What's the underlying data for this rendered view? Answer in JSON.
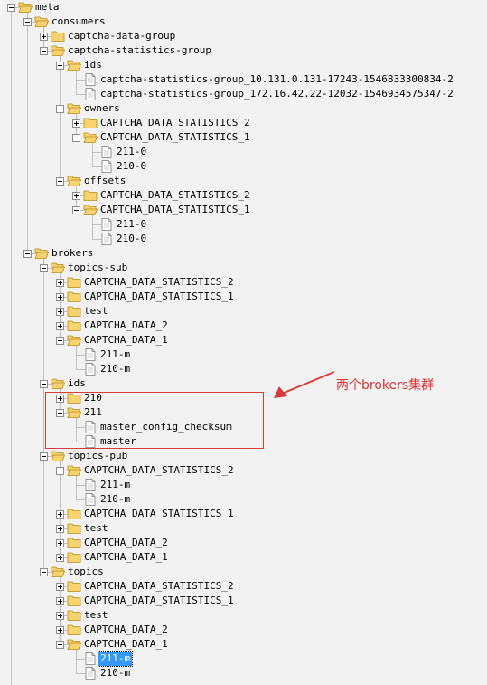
{
  "tree": [
    {
      "label": "meta",
      "type": "folder",
      "depth": 0,
      "expanded": true
    },
    {
      "label": "consumers",
      "type": "folder",
      "depth": 1,
      "expanded": true
    },
    {
      "label": "captcha-data-group",
      "type": "folder",
      "depth": 2,
      "expanded": false
    },
    {
      "label": "captcha-statistics-group",
      "type": "folder",
      "depth": 2,
      "expanded": true
    },
    {
      "label": "ids",
      "type": "folder",
      "depth": 3,
      "expanded": true
    },
    {
      "label": "captcha-statistics-group_10.131.0.131-17243-1546833300834-2",
      "type": "file",
      "depth": 4
    },
    {
      "label": "captcha-statistics-group_172.16.42.22-12032-1546934575347-2",
      "type": "file",
      "depth": 4
    },
    {
      "label": "owners",
      "type": "folder",
      "depth": 3,
      "expanded": true
    },
    {
      "label": "CAPTCHA_DATA_STATISTICS_2",
      "type": "folder",
      "depth": 4,
      "expanded": false
    },
    {
      "label": "CAPTCHA_DATA_STATISTICS_1",
      "type": "folder",
      "depth": 4,
      "expanded": true
    },
    {
      "label": "211-0",
      "type": "file",
      "depth": 5
    },
    {
      "label": "210-0",
      "type": "file",
      "depth": 5
    },
    {
      "label": "offsets",
      "type": "folder",
      "depth": 3,
      "expanded": true
    },
    {
      "label": "CAPTCHA_DATA_STATISTICS_2",
      "type": "folder",
      "depth": 4,
      "expanded": false
    },
    {
      "label": "CAPTCHA_DATA_STATISTICS_1",
      "type": "folder",
      "depth": 4,
      "expanded": true
    },
    {
      "label": "211-0",
      "type": "file",
      "depth": 5
    },
    {
      "label": "210-0",
      "type": "file",
      "depth": 5
    },
    {
      "label": "brokers",
      "type": "folder",
      "depth": 1,
      "expanded": true
    },
    {
      "label": "topics-sub",
      "type": "folder",
      "depth": 2,
      "expanded": true
    },
    {
      "label": "CAPTCHA_DATA_STATISTICS_2",
      "type": "folder",
      "depth": 3,
      "expanded": false
    },
    {
      "label": "CAPTCHA_DATA_STATISTICS_1",
      "type": "folder",
      "depth": 3,
      "expanded": false
    },
    {
      "label": "test",
      "type": "folder",
      "depth": 3,
      "expanded": false
    },
    {
      "label": "CAPTCHA_DATA_2",
      "type": "folder",
      "depth": 3,
      "expanded": false
    },
    {
      "label": "CAPTCHA_DATA_1",
      "type": "folder",
      "depth": 3,
      "expanded": true
    },
    {
      "label": "211-m",
      "type": "file",
      "depth": 4
    },
    {
      "label": "210-m",
      "type": "file",
      "depth": 4
    },
    {
      "label": "ids",
      "type": "folder",
      "depth": 2,
      "expanded": true
    },
    {
      "label": "210",
      "type": "folder",
      "depth": 3,
      "expanded": false
    },
    {
      "label": "211",
      "type": "folder",
      "depth": 3,
      "expanded": true
    },
    {
      "label": "master_config_checksum",
      "type": "file",
      "depth": 4
    },
    {
      "label": "master",
      "type": "file",
      "depth": 4
    },
    {
      "label": "topics-pub",
      "type": "folder",
      "depth": 2,
      "expanded": true
    },
    {
      "label": "CAPTCHA_DATA_STATISTICS_2",
      "type": "folder",
      "depth": 3,
      "expanded": true
    },
    {
      "label": "211-m",
      "type": "file",
      "depth": 4
    },
    {
      "label": "210-m",
      "type": "file",
      "depth": 4
    },
    {
      "label": "CAPTCHA_DATA_STATISTICS_1",
      "type": "folder",
      "depth": 3,
      "expanded": false
    },
    {
      "label": "test",
      "type": "folder",
      "depth": 3,
      "expanded": false
    },
    {
      "label": "CAPTCHA_DATA_2",
      "type": "folder",
      "depth": 3,
      "expanded": false
    },
    {
      "label": "CAPTCHA_DATA_1",
      "type": "folder",
      "depth": 3,
      "expanded": false
    },
    {
      "label": "topics",
      "type": "folder",
      "depth": 2,
      "expanded": true
    },
    {
      "label": "CAPTCHA_DATA_STATISTICS_2",
      "type": "folder",
      "depth": 3,
      "expanded": false
    },
    {
      "label": "CAPTCHA_DATA_STATISTICS_1",
      "type": "folder",
      "depth": 3,
      "expanded": false
    },
    {
      "label": "test",
      "type": "folder",
      "depth": 3,
      "expanded": false
    },
    {
      "label": "CAPTCHA_DATA_2",
      "type": "folder",
      "depth": 3,
      "expanded": false
    },
    {
      "label": "CAPTCHA_DATA_1",
      "type": "folder",
      "depth": 3,
      "expanded": true
    },
    {
      "label": "211-m",
      "type": "file",
      "depth": 4,
      "selected": true
    },
    {
      "label": "210-m",
      "type": "file",
      "depth": 4
    }
  ],
  "annotation": {
    "text": "两个brokers集群",
    "color": "#d93b3b"
  },
  "colors": {
    "background": "#f2f2f2",
    "selection": "#3399ff",
    "folder": "#f6d36b",
    "folder_edge": "#b88a1e",
    "tree_line": "#8c8c8c"
  }
}
